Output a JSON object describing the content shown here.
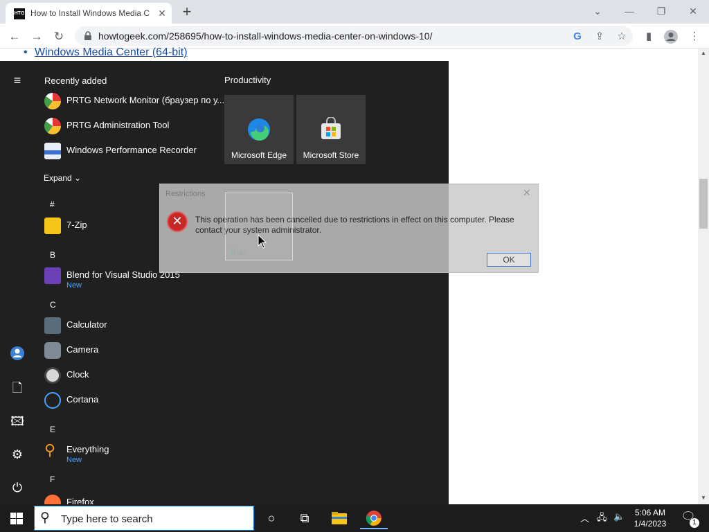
{
  "browser": {
    "tab_title": "How to Install Windows Media C",
    "tab_favicon_text": "HTG",
    "url": "howtogeek.com/258695/how-to-install-windows-media-center-on-windows-10/"
  },
  "page": {
    "link_text": "Windows Media Center (64-bit)"
  },
  "start_menu": {
    "recently_added_label": "Recently added",
    "recent": [
      {
        "name": "PRTG Network Monitor (браузер по у..."
      },
      {
        "name": "PRTG Administration Tool"
      },
      {
        "name": "Windows Performance Recorder"
      }
    ],
    "expand_label": "Expand",
    "letters": {
      "hash": "#",
      "b": "B",
      "c": "C",
      "e": "E",
      "f": "F"
    },
    "apps": {
      "seven_zip": "7-Zip",
      "blend": "Blend for Visual Studio 2015",
      "blend_badge": "New",
      "calculator": "Calculator",
      "camera": "Camera",
      "clock": "Clock",
      "cortana": "Cortana",
      "everything": "Everything",
      "everything_badge": "New",
      "firefox": "Firefox"
    },
    "tiles_group": "Productivity",
    "tiles": [
      {
        "label": "Microsoft Edge"
      },
      {
        "label": "Microsoft Store"
      }
    ]
  },
  "dialog": {
    "title": "Restrictions",
    "message": "This operation has been cancelled due to restrictions in effect on this computer. Please contact your system administrator.",
    "ok_label": "OK",
    "ghost_label": "Run"
  },
  "taskbar": {
    "search_placeholder": "Type here to search",
    "time": "5:06 AM",
    "date": "1/4/2023",
    "notification_count": "1"
  },
  "colors": {
    "start_bg": "#202020",
    "accent_blue": "#0078d4",
    "error_red": "#c62828"
  }
}
